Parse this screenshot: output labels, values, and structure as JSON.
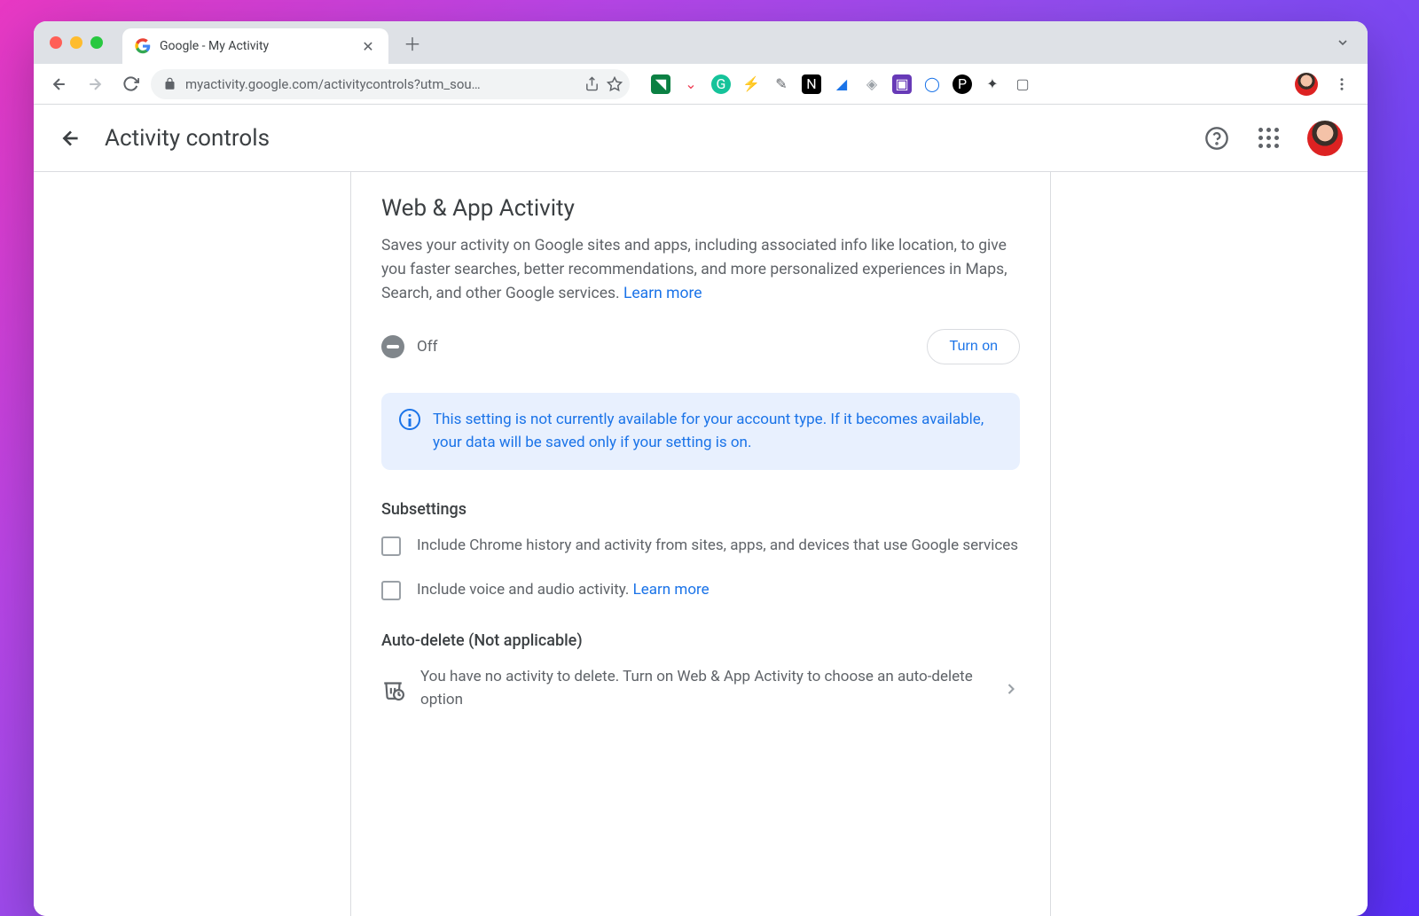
{
  "browser": {
    "tab_title": "Google - My Activity",
    "url_display": "myactivity.google.com/activitycontrols?utm_sou…"
  },
  "extensions": [
    {
      "name": "ext-green-square",
      "glyph": "◥",
      "bg": "#0b8043",
      "fg": "#fff"
    },
    {
      "name": "ext-pocket",
      "glyph": "⌄",
      "bg": "transparent",
      "fg": "#ef4056"
    },
    {
      "name": "ext-grammarly",
      "glyph": "G",
      "bg": "#15c39a",
      "fg": "#fff"
    },
    {
      "name": "ext-bolt",
      "glyph": "⚡",
      "bg": "transparent",
      "fg": "#f29900"
    },
    {
      "name": "ext-edit",
      "glyph": "✎",
      "bg": "transparent",
      "fg": "#5f6368"
    },
    {
      "name": "ext-notion",
      "glyph": "N",
      "bg": "#000",
      "fg": "#fff"
    },
    {
      "name": "ext-sail",
      "glyph": "◢",
      "bg": "transparent",
      "fg": "#1a73e8"
    },
    {
      "name": "ext-diamond",
      "glyph": "◈",
      "bg": "transparent",
      "fg": "#9aa0a6"
    },
    {
      "name": "ext-purple",
      "glyph": "▣",
      "bg": "#673ab7",
      "fg": "#fff"
    },
    {
      "name": "ext-circle-badge",
      "glyph": "◯",
      "bg": "transparent",
      "fg": "#1a73e8"
    },
    {
      "name": "ext-p-circle",
      "glyph": "P",
      "bg": "#000",
      "fg": "#fff"
    },
    {
      "name": "ext-puzzle",
      "glyph": "✦",
      "bg": "transparent",
      "fg": "#3c4043"
    },
    {
      "name": "ext-panel",
      "glyph": "▢",
      "bg": "transparent",
      "fg": "#5f6368"
    }
  ],
  "page": {
    "header_title": "Activity controls",
    "section_title": "Web & App Activity",
    "description": "Saves your activity on Google sites and apps, including associated info like location, to give you faster searches, better recommendations, and more personalized experiences in Maps, Search, and other Google services. ",
    "learn_more": "Learn more",
    "status_label": "Off",
    "turn_on_label": "Turn on",
    "info_text": "This setting is not currently available for your account type. If it becomes available, your data will be saved only if your setting is on.",
    "subsettings_title": "Subsettings",
    "sub1": "Include Chrome history and activity from sites, apps, and devices that use Google services",
    "sub2_prefix": "Include voice and audio activity. ",
    "sub2_link": "Learn more",
    "autodelete_title": "Auto-delete (Not applicable)",
    "autodelete_text": "You have no activity to delete. Turn on Web & App Activity to choose an auto-delete option"
  }
}
